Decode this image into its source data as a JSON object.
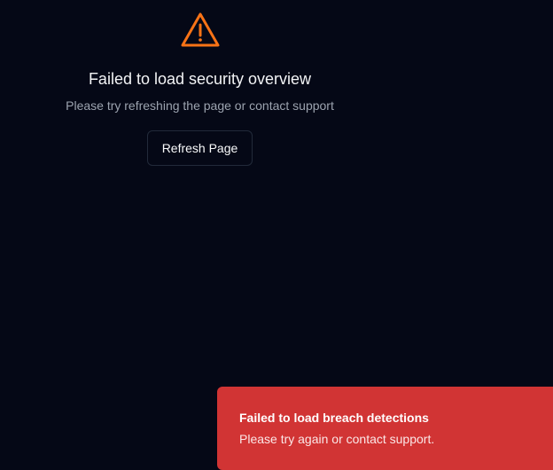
{
  "error": {
    "icon": "warning-triangle-icon",
    "title": "Failed to load security overview",
    "subtitle": "Please try refreshing the page or contact support",
    "button_label": "Refresh Page"
  },
  "toast": {
    "title": "Failed to load breach detections",
    "message": "Please try again or contact support."
  },
  "colors": {
    "background": "#050816",
    "warning": "#f97316",
    "toast": "#d13434"
  }
}
